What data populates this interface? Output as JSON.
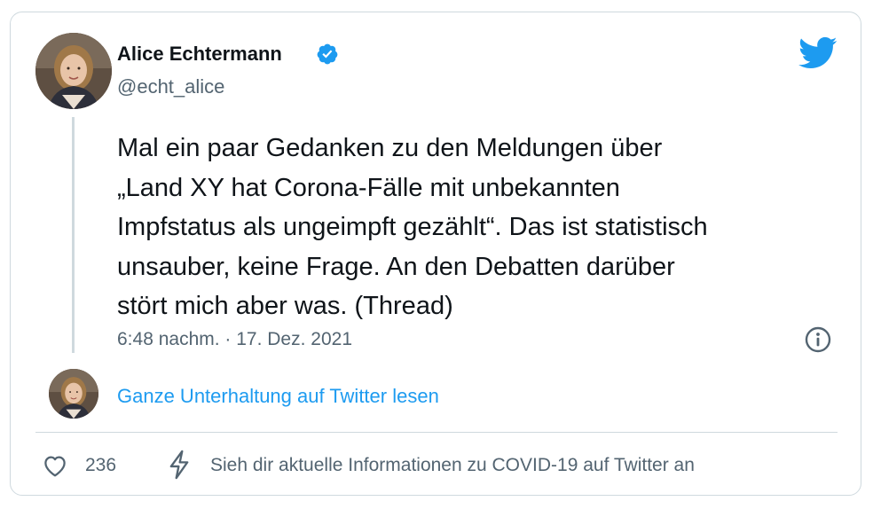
{
  "author": {
    "name": "Alice Echtermann",
    "handle": "@echt_alice",
    "verified": true
  },
  "tweet": {
    "text": "Mal ein paar Gedanken zu den Meldungen über\n„Land XY hat Corona-Fälle mit unbekannten\nImpfstatus als ungeimpft gezählt“. Das ist statistisch\nunsauber, keine Frage. An den Debatten darüber\nstört mich aber was. (Thread)",
    "timestamp": "6:48 nachm. · 17. Dez. 2021"
  },
  "thread": {
    "read_link": "Ganze Unterhaltung auf Twitter lesen"
  },
  "footer": {
    "like_count": "236",
    "covid_link": "Sieh dir aktuelle Informationen zu COVID-19 auf Twitter an"
  },
  "icons": {
    "brand": "twitter-bird-icon",
    "verified": "verified-badge-icon",
    "info": "info-icon",
    "like": "heart-icon",
    "covid": "lightning-bolt-icon"
  },
  "colors": {
    "brand_blue": "#1d9bf0",
    "text_primary": "#0f1419",
    "text_secondary": "#536471",
    "border": "#cfd9de"
  }
}
